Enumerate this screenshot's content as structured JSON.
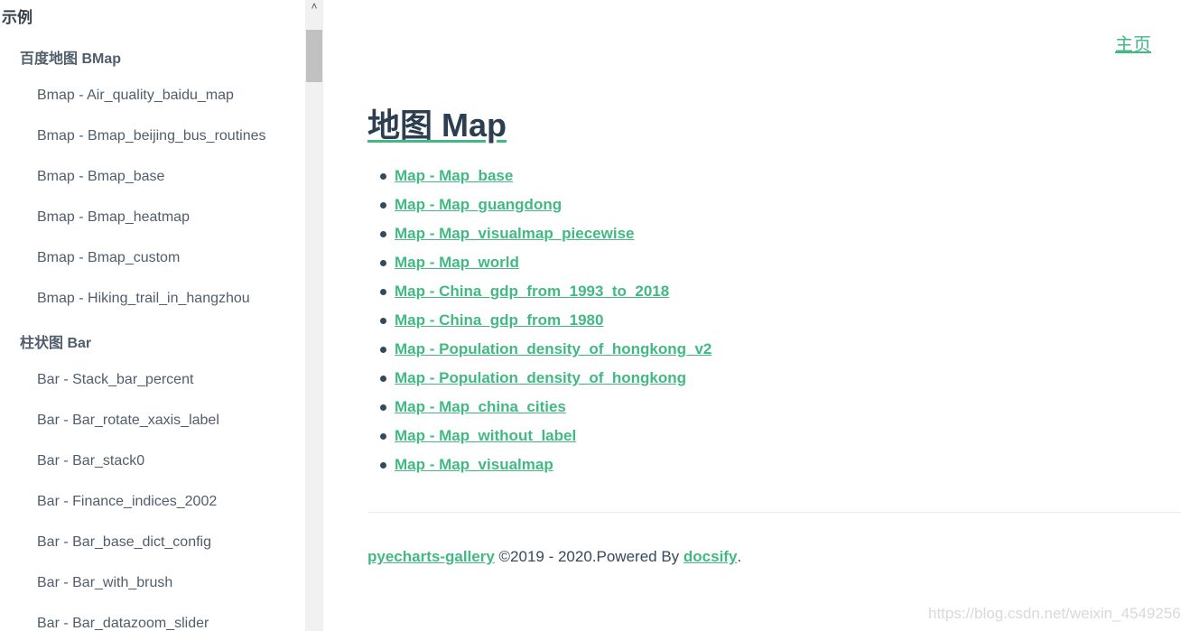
{
  "sidebar": {
    "heading": "示例",
    "groups": [
      {
        "title": "百度地图 BMap",
        "items": [
          "Bmap - Air_quality_baidu_map",
          "Bmap - Bmap_beijing_bus_routines",
          "Bmap - Bmap_base",
          "Bmap - Bmap_heatmap",
          "Bmap - Bmap_custom",
          "Bmap - Hiking_trail_in_hangzhou"
        ]
      },
      {
        "title": "柱状图 Bar",
        "items": [
          "Bar - Stack_bar_percent",
          "Bar - Bar_rotate_xaxis_label",
          "Bar - Bar_stack0",
          "Bar - Finance_indices_2002",
          "Bar - Bar_base_dict_config",
          "Bar - Bar_with_brush",
          "Bar - Bar_datazoom_slider"
        ]
      }
    ]
  },
  "scrollbar": {
    "up_arrow": "˄"
  },
  "header": {
    "home_link": "主页"
  },
  "main": {
    "title": "地图 Map",
    "links": [
      "Map - Map_base",
      "Map - Map_guangdong",
      "Map - Map_visualmap_piecewise",
      "Map - Map_world",
      "Map - China_gdp_from_1993_to_2018",
      "Map - China_gdp_from_1980",
      "Map - Population_density_of_hongkong_v2",
      "Map - Population_density_of_hongkong",
      "Map - Map_china_cities",
      "Map - Map_without_label",
      "Map - Map_visualmap"
    ]
  },
  "footer": {
    "gallery_link": "pyecharts-gallery",
    "copyright_text": " ©2019 - 2020.Powered By ",
    "docsify_link": "docsify",
    "end_period": "."
  },
  "watermark": "https://blog.csdn.net/weixin_45492560",
  "colors": {
    "accent": "#42b983",
    "text": "#34495e",
    "heading": "#2c3e50"
  }
}
